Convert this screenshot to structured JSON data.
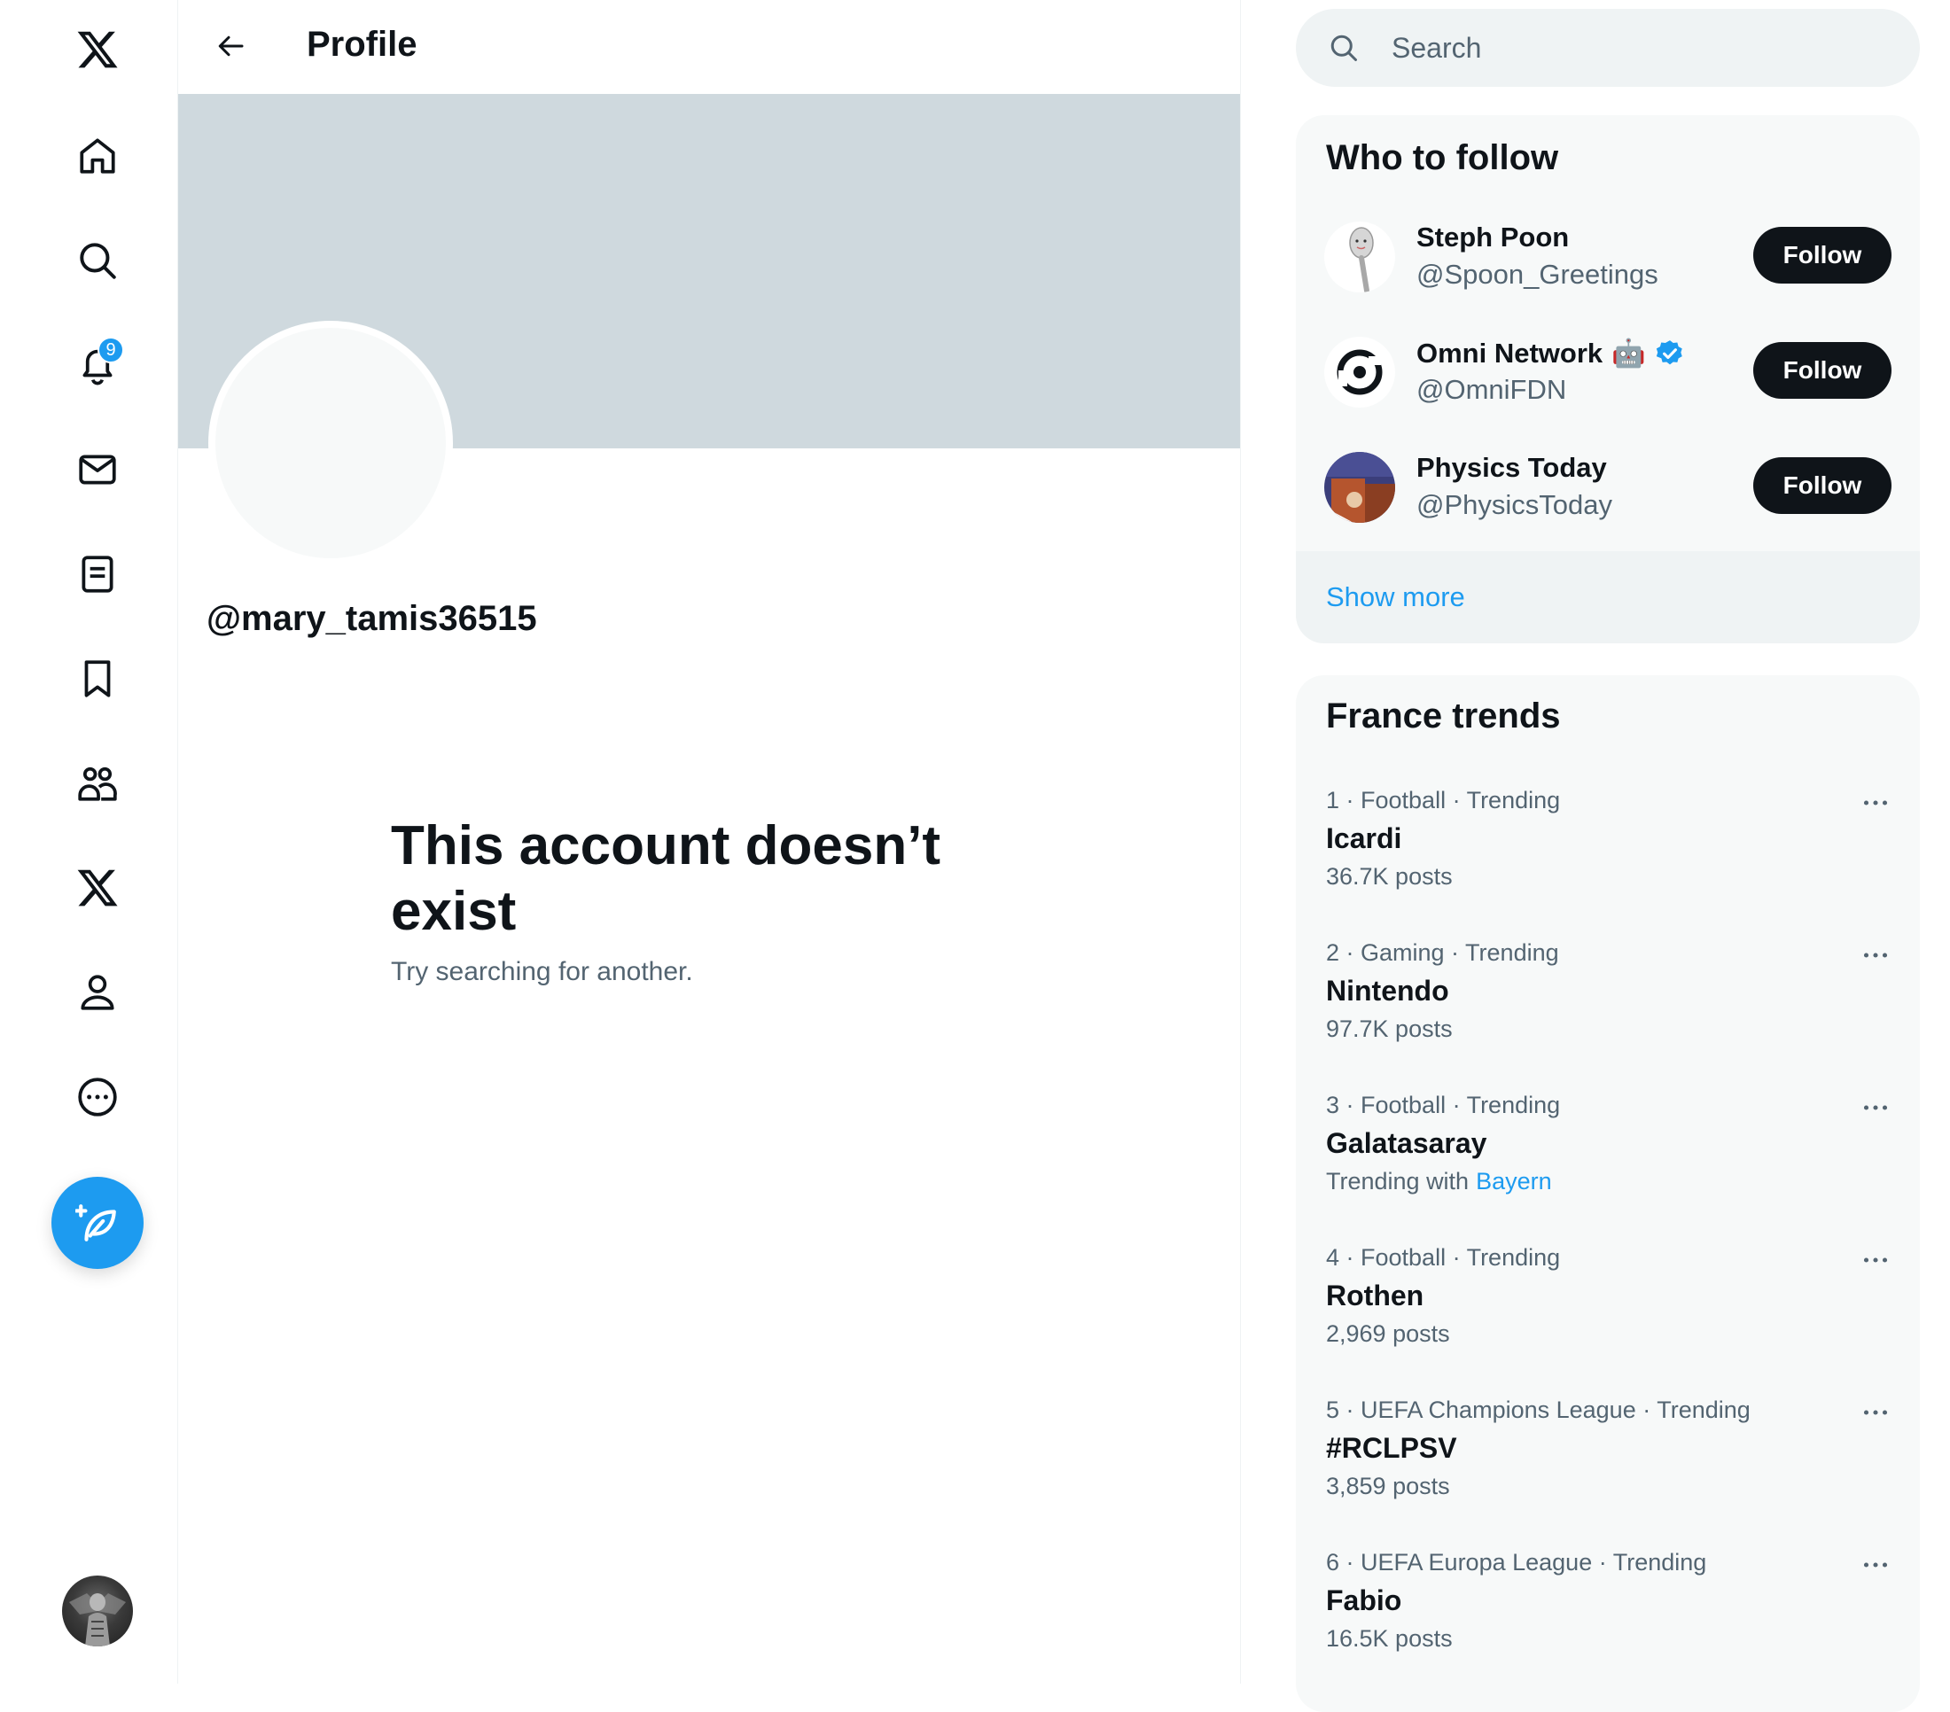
{
  "app": {
    "accent_color": "#1d9bf0"
  },
  "nav": {
    "items": [
      {
        "name": "x-logo",
        "icon": "x-logo-icon"
      },
      {
        "name": "home",
        "icon": "home-icon"
      },
      {
        "name": "explore",
        "icon": "search-icon"
      },
      {
        "name": "notifications",
        "icon": "bell-icon",
        "badge": "9"
      },
      {
        "name": "messages",
        "icon": "envelope-icon"
      },
      {
        "name": "lists",
        "icon": "list-icon"
      },
      {
        "name": "bookmarks",
        "icon": "bookmark-icon"
      },
      {
        "name": "communities",
        "icon": "communities-icon"
      },
      {
        "name": "premium",
        "icon": "x-logo-icon"
      },
      {
        "name": "profile",
        "icon": "person-icon"
      },
      {
        "name": "more",
        "icon": "more-circle-icon"
      }
    ],
    "compose_icon": "compose-post-icon",
    "notifications_badge": "9"
  },
  "header": {
    "title": "Profile"
  },
  "profile": {
    "handle": "@mary_tamis36515",
    "empty_title": "This account doesn’t exist",
    "empty_subtitle": "Try searching for another."
  },
  "search": {
    "placeholder": "Search"
  },
  "who_to_follow": {
    "title": "Who to follow",
    "accounts": [
      {
        "name": "Steph Poon",
        "handle": "@Spoon_Greetings",
        "button": "Follow"
      },
      {
        "name": "Omni Network",
        "emoji": "🤖",
        "verified": true,
        "handle": "@OmniFDN",
        "button": "Follow"
      },
      {
        "name": "Physics Today",
        "handle": "@PhysicsToday",
        "button": "Follow"
      }
    ],
    "show_more": "Show more"
  },
  "trends": {
    "title": "France trends",
    "items": [
      {
        "meta": "1 · Football · Trending",
        "name": "Icardi",
        "count": "36.7K posts"
      },
      {
        "meta": "2 · Gaming · Trending",
        "name": "Nintendo",
        "count": "97.7K posts"
      },
      {
        "meta": "3 · Football · Trending",
        "name": "Galatasaray",
        "count_prefix": "Trending with",
        "count_link": "Bayern"
      },
      {
        "meta": "4 · Football · Trending",
        "name": "Rothen",
        "count": "2,969 posts"
      },
      {
        "meta": "5 · UEFA Champions League · Trending",
        "name": "#RCLPSV",
        "count": "3,859 posts"
      },
      {
        "meta": "6 · UEFA Europa League · Trending",
        "name": "Fabio",
        "count": "16.5K posts"
      }
    ]
  }
}
